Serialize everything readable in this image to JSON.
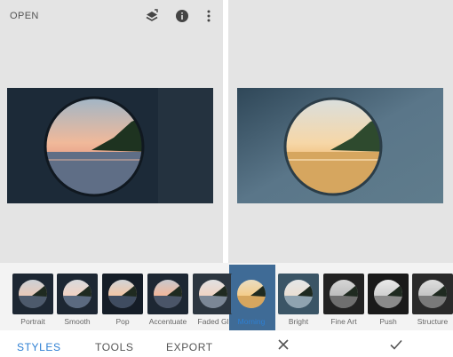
{
  "toolbar": {
    "open_label": "OPEN",
    "icons": [
      "layers-undo-icon",
      "info-icon",
      "more-vert-icon"
    ]
  },
  "styles": [
    {
      "label": "Portrait"
    },
    {
      "label": "Smooth"
    },
    {
      "label": "Pop"
    },
    {
      "label": "Accentuate"
    },
    {
      "label": "Faded Gl"
    },
    {
      "label": "Morning",
      "selected": true
    },
    {
      "label": "Bright"
    },
    {
      "label": "Fine Art"
    },
    {
      "label": "Push"
    },
    {
      "label": "Structure"
    }
  ],
  "bottom_bar": {
    "tabs": [
      "STYLES",
      "TOOLS",
      "EXPORT"
    ],
    "active_tab": "STYLES",
    "cancel_icon": "close-icon",
    "apply_icon": "check-icon"
  },
  "colors": {
    "accent": "#2d7fd3",
    "pane_background": "#e4e4e4"
  }
}
